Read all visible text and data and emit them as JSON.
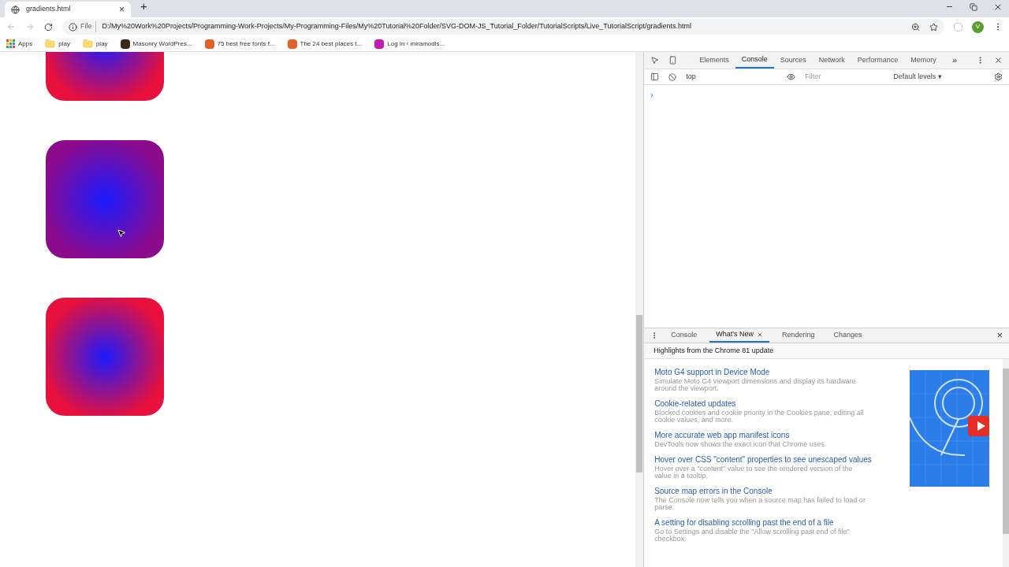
{
  "browser": {
    "tab": {
      "title": "gradients.html",
      "close": "×"
    },
    "new_tab": "+",
    "scheme": "File",
    "url": "D:/My%20Work%20Projects/Programming-Work-Projects/My-Programming-Files/My%20Tutorial%20Folder/SVG-DOM-JS_Tutorial_Folder/TutorialScripts/Live_TutorialScript/gradients.html",
    "avatar": "V",
    "bookmarks": [
      {
        "kind": "apps",
        "label": "Apps"
      },
      {
        "kind": "folder",
        "label": "play"
      },
      {
        "kind": "folder",
        "label": "play"
      },
      {
        "kind": "site",
        "label": "Masonry WordPres...",
        "color": "#3a2a1a"
      },
      {
        "kind": "site",
        "label": "75 best free fonts f...",
        "color": "#e0612a"
      },
      {
        "kind": "site",
        "label": "The 24 best places t...",
        "color": "#e0612a"
      },
      {
        "kind": "site",
        "label": "Log In ‹ miramodis...",
        "color": "#c21bb0"
      }
    ]
  },
  "page": {
    "squares": [
      {
        "color": "#e8103c"
      },
      {
        "color": "#8c0a8c"
      },
      {
        "color": "#e8103c"
      }
    ]
  },
  "devtools": {
    "tabs": [
      {
        "label": "Elements",
        "selected": false
      },
      {
        "label": "Console",
        "selected": true
      },
      {
        "label": "Sources",
        "selected": false
      },
      {
        "label": "Network",
        "selected": false
      },
      {
        "label": "Performance",
        "selected": false
      },
      {
        "label": "Memory",
        "selected": false
      }
    ],
    "more": "»",
    "context": "top",
    "filter_placeholder": "Filter",
    "levels": "Default levels ▾",
    "prompt": "›",
    "drawer": {
      "tabs": [
        {
          "label": "Console",
          "selected": false,
          "closable": false
        },
        {
          "label": "What's New",
          "selected": true,
          "closable": true
        },
        {
          "label": "Rendering",
          "selected": false,
          "closable": false
        },
        {
          "label": "Changes",
          "selected": false,
          "closable": false
        }
      ],
      "close_mark": "×",
      "heading": "Highlights from the Chrome 81 update",
      "items": [
        {
          "title": "Moto G4 support in Device Mode",
          "text": "Simulate Moto G4 viewport dimensions and display its hardware around the viewport."
        },
        {
          "title": "Cookie-related updates",
          "text": "Blocked cookies and cookie priority in the Cookies pane, editing all cookie values, and more."
        },
        {
          "title": "More accurate web app manifest icons",
          "text": "DevTools now shows the exact icon that Chrome uses."
        },
        {
          "title": "Hover over CSS \"content\" properties to see unescaped values",
          "text": "Hover over a \"content\" value to see the rendered version of the value in a tooltip."
        },
        {
          "title": "Source map errors in the Console",
          "text": "The Console now tells you when a source map has failed to load or parse."
        },
        {
          "title": "A setting for disabling scrolling past the end of a file",
          "text": "Go to Settings and disable the \"Allow scrolling past end of file\" checkbox."
        }
      ]
    }
  }
}
